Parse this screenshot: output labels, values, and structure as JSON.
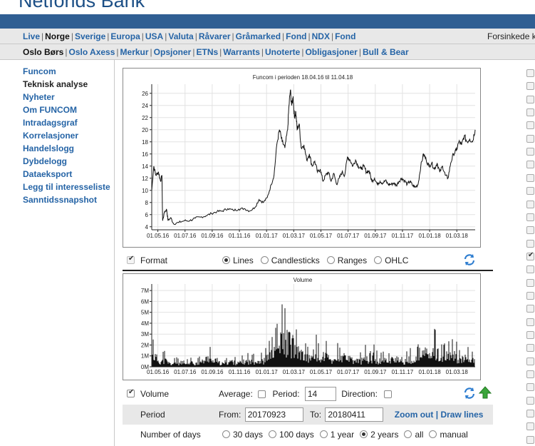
{
  "brand": {
    "logo": "Netfonds Bank",
    "accent": "#305f93",
    "link_color": "#2564a6"
  },
  "nav_primary": {
    "items": [
      {
        "label": "Live",
        "current": false
      },
      {
        "label": "Norge",
        "current": true
      },
      {
        "label": "Sverige",
        "current": false
      },
      {
        "label": "Europa",
        "current": false
      },
      {
        "label": "USA",
        "current": false
      },
      {
        "label": "Valuta",
        "current": false
      },
      {
        "label": "Råvarer",
        "current": false
      },
      {
        "label": "Gråmarked",
        "current": false
      },
      {
        "label": "Fond",
        "current": false
      },
      {
        "label": "NDX",
        "current": false
      },
      {
        "label": "Fond",
        "current": false
      }
    ],
    "right_label": "Forsinkede k"
  },
  "nav_secondary": {
    "items": [
      {
        "label": "Oslo Børs",
        "current": true
      },
      {
        "label": "Oslo Axess",
        "current": false
      },
      {
        "label": "Merkur",
        "current": false
      },
      {
        "label": "Opsjoner",
        "current": false
      },
      {
        "label": "ETNs",
        "current": false
      },
      {
        "label": "Warrants",
        "current": false
      },
      {
        "label": "Unoterte",
        "current": false
      },
      {
        "label": "Obligasjoner",
        "current": false
      },
      {
        "label": "Bull & Bear",
        "current": false
      }
    ]
  },
  "sidebar": {
    "items": [
      {
        "label": "Funcom",
        "current": false
      },
      {
        "label": "Teknisk analyse",
        "current": true
      },
      {
        "label": "Nyheter",
        "current": false
      },
      {
        "label": "Om FUNCOM",
        "current": false
      },
      {
        "label": "Intradagsgraf",
        "current": false
      },
      {
        "label": "Korrelasjoner",
        "current": false
      },
      {
        "label": "Handelslogg",
        "current": false
      },
      {
        "label": "Dybdelogg",
        "current": false
      },
      {
        "label": "Dataeksport",
        "current": false
      },
      {
        "label": "Legg til interesseliste",
        "current": false
      },
      {
        "label": "Sanntidssnapshot",
        "current": false
      }
    ]
  },
  "format_row": {
    "label": "Format",
    "checked": true,
    "options": [
      "Lines",
      "Candlesticks",
      "Ranges",
      "OHLC"
    ],
    "selected": "Lines"
  },
  "volume_row": {
    "label": "Volume",
    "checked": true,
    "average_label": "Average:",
    "average_checked": false,
    "period_label": "Period:",
    "period_value": "14",
    "direction_label": "Direction:",
    "direction_checked": false
  },
  "period_row": {
    "label": "Period",
    "from_label": "From:",
    "from_value": "20170923",
    "to_label": "To:",
    "to_value": "20180411",
    "zoom_out": "Zoom out",
    "sep": "|",
    "draw_lines": "Draw lines"
  },
  "days_row": {
    "label": "Number of days",
    "options": [
      "30 days",
      "100 days",
      "1 year",
      "2 years",
      "all",
      "manual"
    ],
    "selected": "2 years"
  },
  "right_checkboxes": {
    "checked_states": [
      false,
      false,
      false,
      false,
      false,
      false,
      false,
      false,
      false,
      false,
      false,
      false,
      false,
      false,
      true,
      false,
      false,
      false,
      false,
      false,
      false,
      false,
      false,
      false,
      false,
      false,
      false,
      false,
      false,
      false
    ]
  },
  "chart_data": [
    {
      "type": "line",
      "title": "Funcom i perioden 18.04.16 til 11.04.18",
      "xlabel": "",
      "ylabel": "",
      "x_tick_labels": [
        "01.05.16",
        "01.07.16",
        "01.09.16",
        "01.11.16",
        "01.01.17",
        "01.03.17",
        "01.05.17",
        "01.07.17",
        "01.09.17",
        "01.11.17",
        "01.01.18",
        "01.03.18"
      ],
      "x_ticks_month_index": [
        0.45,
        2.45,
        4.45,
        6.45,
        8.45,
        10.45,
        12.45,
        14.45,
        16.45,
        18.45,
        20.45,
        22.45
      ],
      "xlim_months": [
        0,
        23.8
      ],
      "ylim": [
        3.5,
        27.5
      ],
      "y_ticks": [
        4,
        6,
        8,
        10,
        12,
        14,
        16,
        18,
        20,
        22,
        24,
        26
      ],
      "grid": true,
      "series": [
        {
          "points": [
            [
              0.0,
              10.0
            ],
            [
              0.15,
              14.0
            ],
            [
              0.3,
              12.5
            ],
            [
              0.5,
              13.0
            ],
            [
              0.65,
              11.5
            ],
            [
              0.75,
              12.5
            ],
            [
              0.8,
              5.0
            ],
            [
              0.95,
              6.5
            ],
            [
              1.1,
              6.8
            ],
            [
              1.2,
              5.0
            ],
            [
              1.4,
              5.5
            ],
            [
              1.6,
              4.5
            ],
            [
              2.0,
              4.7
            ],
            [
              2.4,
              5.0
            ],
            [
              2.8,
              5.0
            ],
            [
              3.2,
              5.4
            ],
            [
              3.6,
              5.6
            ],
            [
              4.0,
              5.8
            ],
            [
              4.4,
              6.2
            ],
            [
              4.8,
              6.5
            ],
            [
              5.2,
              6.6
            ],
            [
              5.6,
              7.0
            ],
            [
              6.0,
              6.7
            ],
            [
              6.4,
              6.9
            ],
            [
              6.8,
              7.0
            ],
            [
              7.2,
              6.6
            ],
            [
              7.6,
              7.2
            ],
            [
              7.9,
              8.5
            ],
            [
              8.2,
              8.0
            ],
            [
              8.5,
              8.8
            ],
            [
              8.8,
              11.0
            ],
            [
              9.0,
              12.5
            ],
            [
              9.2,
              17.5
            ],
            [
              9.4,
              20.0
            ],
            [
              9.6,
              18.0
            ],
            [
              9.8,
              17.0
            ],
            [
              10.0,
              20.0
            ],
            [
              10.1,
              24.0
            ],
            [
              10.2,
              26.5
            ],
            [
              10.3,
              24.0
            ],
            [
              10.4,
              25.5
            ],
            [
              10.5,
              22.0
            ],
            [
              10.6,
              23.0
            ],
            [
              10.7,
              20.0
            ],
            [
              10.85,
              21.0
            ],
            [
              11.0,
              17.0
            ],
            [
              11.2,
              17.5
            ],
            [
              11.4,
              15.0
            ],
            [
              11.6,
              16.0
            ],
            [
              11.8,
              14.0
            ],
            [
              12.0,
              14.8
            ],
            [
              12.2,
              13.0
            ],
            [
              12.4,
              13.5
            ],
            [
              12.6,
              11.5
            ],
            [
              12.8,
              12.5
            ],
            [
              13.0,
              13.0
            ],
            [
              13.2,
              11.5
            ],
            [
              13.4,
              12.8
            ],
            [
              13.6,
              11.0
            ],
            [
              13.8,
              12.0
            ],
            [
              14.0,
              13.0
            ],
            [
              14.2,
              12.5
            ],
            [
              14.4,
              15.5
            ],
            [
              14.6,
              15.0
            ],
            [
              14.8,
              14.0
            ],
            [
              15.0,
              15.0
            ],
            [
              15.2,
              14.0
            ],
            [
              15.4,
              13.5
            ],
            [
              15.6,
              14.0
            ],
            [
              15.8,
              13.0
            ],
            [
              16.0,
              13.2
            ],
            [
              16.2,
              11.5
            ],
            [
              16.4,
              12.0
            ],
            [
              16.6,
              11.0
            ],
            [
              16.8,
              11.5
            ],
            [
              17.0,
              11.2
            ],
            [
              17.2,
              11.6
            ],
            [
              17.4,
              11.0
            ],
            [
              17.6,
              11.0
            ],
            [
              17.8,
              11.2
            ],
            [
              18.0,
              10.8
            ],
            [
              18.2,
              11.5
            ],
            [
              18.4,
              12.0
            ],
            [
              18.6,
              11.6
            ],
            [
              18.8,
              11.0
            ],
            [
              19.0,
              11.5
            ],
            [
              19.2,
              10.8
            ],
            [
              19.4,
              10.5
            ],
            [
              19.6,
              11.0
            ],
            [
              19.8,
              14.0
            ],
            [
              20.0,
              16.0
            ],
            [
              20.2,
              15.0
            ],
            [
              20.4,
              14.0
            ],
            [
              20.6,
              14.5
            ],
            [
              20.8,
              13.5
            ],
            [
              21.0,
              14.5
            ],
            [
              21.2,
              13.0
            ],
            [
              21.4,
              14.0
            ],
            [
              21.6,
              12.5
            ],
            [
              21.8,
              12.0
            ],
            [
              22.0,
              14.5
            ],
            [
              22.2,
              16.0
            ],
            [
              22.4,
              16.5
            ],
            [
              22.6,
              18.0
            ],
            [
              22.8,
              17.5
            ],
            [
              23.0,
              19.0
            ],
            [
              23.2,
              18.0
            ],
            [
              23.4,
              18.5
            ],
            [
              23.6,
              18.0
            ],
            [
              23.8,
              20.0
            ]
          ]
        }
      ]
    },
    {
      "type": "bar",
      "title": "Volume",
      "xlabel": "",
      "ylabel": "",
      "x_tick_labels": [
        "01.05.16",
        "01.07.16",
        "01.09.16",
        "01.11.16",
        "01.01.17",
        "01.03.17",
        "01.05.17",
        "01.07.17",
        "01.09.17",
        "01.11.17",
        "01.01.18",
        "01.03.18"
      ],
      "ylim": [
        0,
        7600000
      ],
      "y_tick_labels": [
        "0M",
        "1M",
        "2M",
        "3M",
        "4M",
        "5M",
        "6M",
        "7M"
      ],
      "grid": true,
      "series": [
        {
          "x_months": [
            0.2,
            0.6,
            1.0,
            1.4,
            1.8,
            2.2,
            2.6,
            3.0,
            3.4,
            3.8,
            4.2,
            4.6,
            5.0,
            5.4,
            5.8,
            6.2,
            6.6,
            7.0,
            7.4,
            7.8,
            8.2,
            8.6,
            8.9,
            9.1,
            9.3,
            9.5,
            9.7,
            9.9,
            10.0,
            10.1,
            10.2,
            10.3,
            10.4,
            10.5,
            10.7,
            10.9,
            11.1,
            11.3,
            11.5,
            11.7,
            11.9,
            12.1,
            12.4,
            12.7,
            13.0,
            13.3,
            13.6,
            13.9,
            14.2,
            14.5,
            14.8,
            15.1,
            15.4,
            15.7,
            16.0,
            16.3,
            16.6,
            16.9,
            17.2,
            17.5,
            17.8,
            18.1,
            18.4,
            18.7,
            19.0,
            19.3,
            19.6,
            19.9,
            20.2,
            20.5,
            20.8,
            21.1,
            21.4,
            21.7,
            22.0,
            22.3,
            22.6,
            22.9,
            23.2,
            23.5,
            23.8
          ],
          "values": [
            2500000,
            1200000,
            1500000,
            600000,
            900000,
            500000,
            700000,
            900000,
            800000,
            1300000,
            2200000,
            700000,
            900000,
            600000,
            1400000,
            800000,
            1000000,
            1300000,
            1100000,
            1500000,
            1200000,
            2300000,
            2800000,
            3500000,
            4200000,
            5500000,
            6000000,
            4800000,
            7000000,
            6200000,
            5200000,
            4500000,
            6000000,
            4000000,
            3200000,
            3800000,
            2500000,
            2200000,
            1800000,
            2500000,
            1600000,
            3000000,
            1500000,
            2800000,
            1900000,
            1200000,
            2400000,
            1600000,
            2500000,
            1800000,
            1400000,
            1500000,
            1300000,
            2100000,
            1100000,
            2200000,
            1400000,
            1300000,
            1500000,
            1200000,
            2300000,
            1600000,
            900000,
            1300000,
            1800000,
            1000000,
            3600000,
            2400000,
            4000000,
            2000000,
            3500000,
            3000000,
            1800000,
            2500000,
            2200000,
            3000000,
            1500000,
            1700000,
            2000000,
            1300000,
            1600000
          ]
        }
      ]
    }
  ]
}
